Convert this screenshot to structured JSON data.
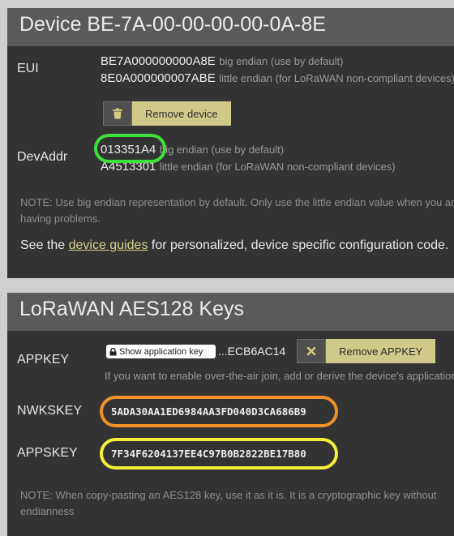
{
  "device": {
    "title": "Device BE-7A-00-00-00-00-0A-8E",
    "eui": {
      "label": "EUI",
      "big": "BE7A000000000A8E",
      "big_hint": "big endian (use by default)",
      "little": "8E0A000000007ABE",
      "little_hint": "little endian (for LoRaWAN non-compliant devices)"
    },
    "remove_label": "Remove device",
    "devaddr": {
      "label": "DevAddr",
      "big": "013351A4",
      "big_hint": "big endian (use by default)",
      "little": "A4513301",
      "little_hint": "little endian (for LoRaWAN non-compliant devices)"
    },
    "note": "NOTE: Use big endian representation by default. Only use the little endian value when you are having problems.",
    "guides_before": "See the ",
    "guides_link": "device guides",
    "guides_after": " for personalized, device specific configuration code."
  },
  "keys": {
    "title": "LoRaWAN AES128 Keys",
    "appkey": {
      "label": "APPKEY",
      "show_label": "Show application key",
      "tail": "...ECB6AC14",
      "remove_label": "Remove APPKEY",
      "hint": "If you want to enable over-the-air join, add or derive the device's application key."
    },
    "nwkskey": {
      "label": "NWKSKEY",
      "value": "5ADA30AA1ED6984AA3FD040D3CA686B9"
    },
    "appskey": {
      "label": "APPSKEY",
      "value": "7F34F6204137EE4C97B0B2822BE17B80"
    },
    "note": "NOTE: When copy-pasting an AES128 key, use it as it is. It is a cryptographic key without endianness"
  },
  "highlights": {
    "devaddr_color": "#3ee03a",
    "nwkskey_color": "#f0902a",
    "appskey_color": "#f6ef3a"
  }
}
